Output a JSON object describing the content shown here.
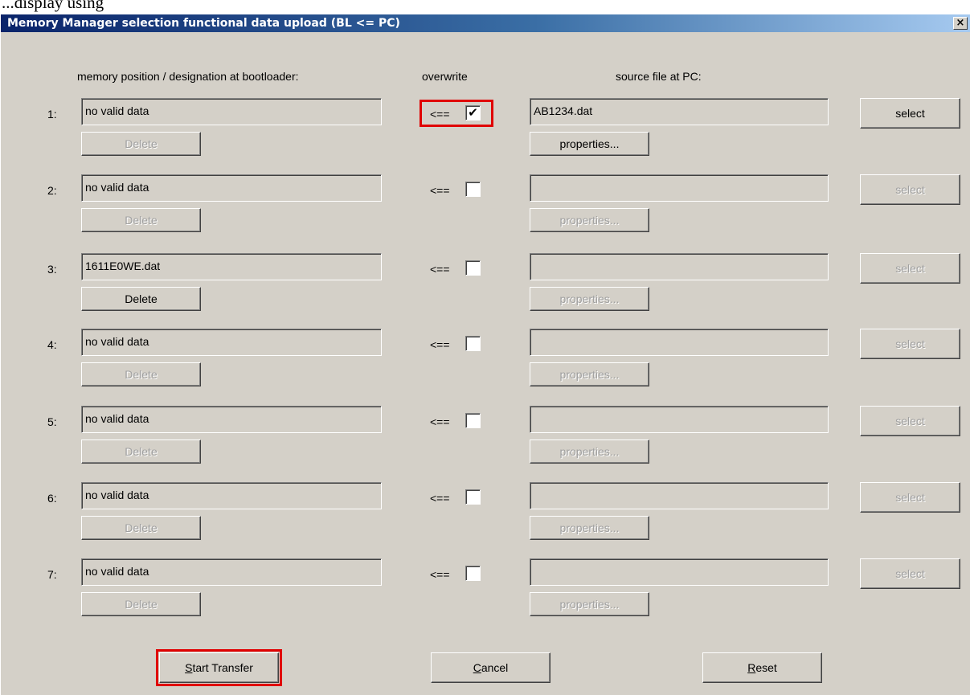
{
  "page_top_text": "...display using",
  "window": {
    "title": "Memory Manager selection functional data upload (BL <= PC)",
    "close_label": "×"
  },
  "headers": {
    "memory": "memory position / designation at bootloader:",
    "overwrite": "overwrite",
    "source": "source file at PC:"
  },
  "rows": [
    {
      "num": "1:",
      "memory": "no valid data",
      "delete_label": "Delete",
      "delete_enabled": false,
      "arrow": "<==",
      "overwrite_checked": true,
      "source": "AB1234.dat",
      "properties_label": "properties...",
      "properties_enabled": true,
      "select_label": "select",
      "select_enabled": true,
      "highlight_checkbox": true
    },
    {
      "num": "2:",
      "memory": "no valid data",
      "delete_label": "Delete",
      "delete_enabled": false,
      "arrow": "<==",
      "overwrite_checked": false,
      "source": "",
      "properties_label": "properties...",
      "properties_enabled": false,
      "select_label": "select",
      "select_enabled": false
    },
    {
      "num": "3:",
      "memory": "1611E0WE.dat",
      "delete_label": "Delete",
      "delete_enabled": true,
      "arrow": "<==",
      "overwrite_checked": false,
      "source": "",
      "properties_label": "properties...",
      "properties_enabled": false,
      "select_label": "select",
      "select_enabled": false
    },
    {
      "num": "4:",
      "memory": "no valid data",
      "delete_label": "Delete",
      "delete_enabled": false,
      "arrow": "<==",
      "overwrite_checked": false,
      "source": "",
      "properties_label": "properties...",
      "properties_enabled": false,
      "select_label": "select",
      "select_enabled": false
    },
    {
      "num": "5:",
      "memory": "no valid data",
      "delete_label": "Delete",
      "delete_enabled": false,
      "arrow": "<==",
      "overwrite_checked": false,
      "source": "",
      "properties_label": "properties...",
      "properties_enabled": false,
      "select_label": "select",
      "select_enabled": false
    },
    {
      "num": "6:",
      "memory": "no valid data",
      "delete_label": "Delete",
      "delete_enabled": false,
      "arrow": "<==",
      "overwrite_checked": false,
      "source": "",
      "properties_label": "properties...",
      "properties_enabled": false,
      "select_label": "select",
      "select_enabled": false
    },
    {
      "num": "7:",
      "memory": "no valid data",
      "delete_label": "Delete",
      "delete_enabled": false,
      "arrow": "<==",
      "overwrite_checked": false,
      "source": "",
      "properties_label": "properties...",
      "properties_enabled": false,
      "select_label": "select",
      "select_enabled": false
    }
  ],
  "buttons": {
    "start_transfer": {
      "mnemonic": "S",
      "rest": "tart Transfer"
    },
    "cancel": {
      "mnemonic": "C",
      "rest": "ancel"
    },
    "reset": {
      "mnemonic": "R",
      "rest": "eset"
    }
  },
  "colors": {
    "dialog_bg": "#d4d0c8",
    "titlebar_start": "#0a246a",
    "titlebar_end": "#a6caf0",
    "highlight": "#e00000"
  }
}
